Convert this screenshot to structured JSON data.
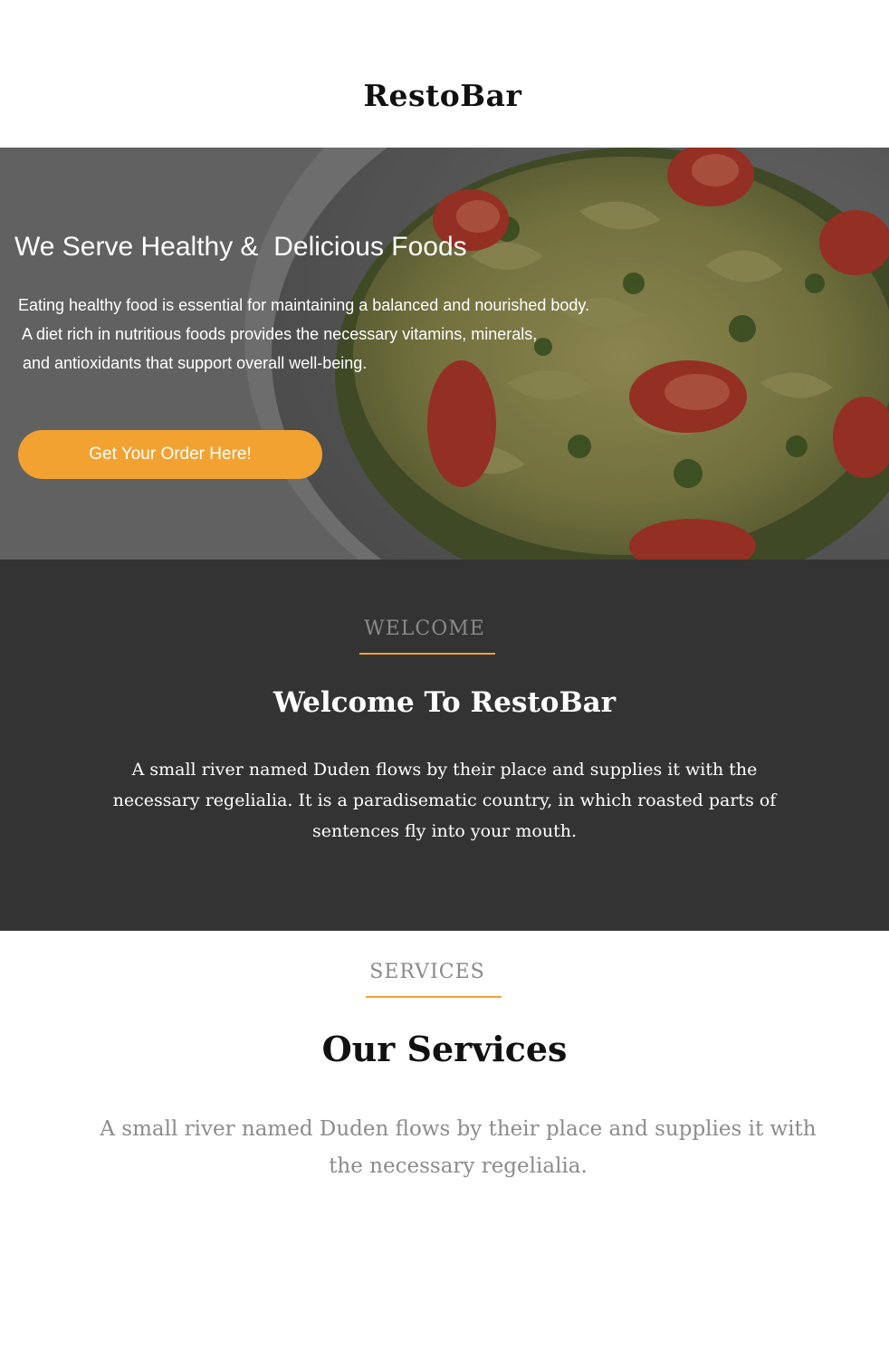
{
  "header": {
    "logo": "RestoBar"
  },
  "hero": {
    "title": "We Serve Healthy &  Delicious Foods",
    "lines": [
      "Eating healthy food is essential for maintaining a balanced and nourished body.",
      " A diet rich in nutritious foods provides the necessary vitamins, minerals,",
      " and antioxidants that support overall well-being."
    ],
    "cta_label": "Get Your Order Here!"
  },
  "welcome": {
    "eyebrow": "WELCOME",
    "heading": "Welcome To RestoBar",
    "text": "A small river named Duden flows by their place and supplies it with the necessary regelialia. It is a paradisematic country, in which roasted parts of sentences fly into your mouth."
  },
  "services": {
    "eyebrow": "SERVICES",
    "heading": "Our Services",
    "text": "A small river named Duden flows by their place and supplies it with the necessary regelialia."
  },
  "colors": {
    "accent": "#f2a231",
    "dark_section": "#333333",
    "muted_text": "#8c8c8c"
  }
}
